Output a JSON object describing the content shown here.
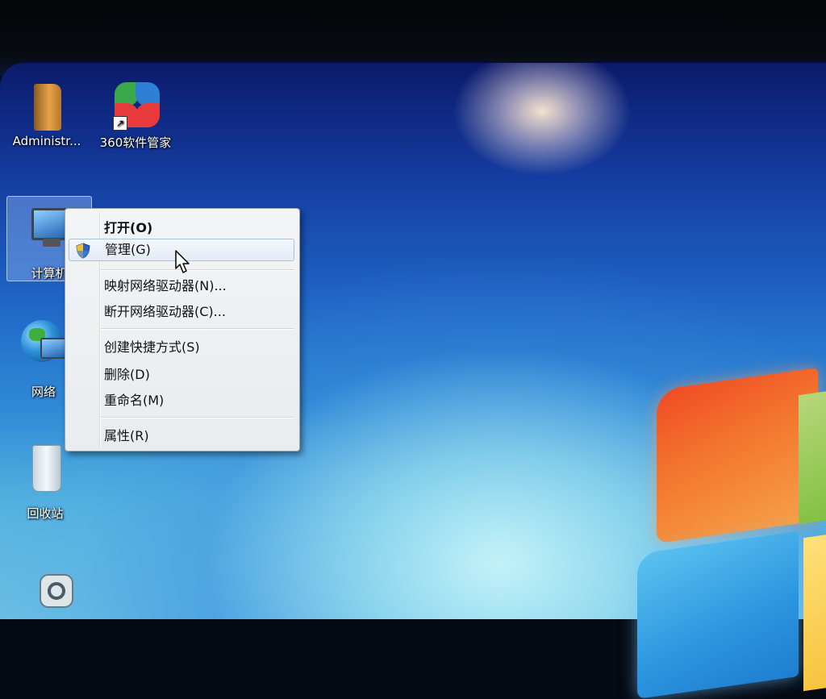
{
  "desktop": {
    "icons": [
      {
        "label": "Administr...",
        "icon": "folder-icon"
      },
      {
        "label": "360软件管家",
        "icon": "360-software-manager-icon"
      },
      {
        "label": "计算机",
        "icon": "computer-icon"
      },
      {
        "label": "网络",
        "icon": "network-globe-icon"
      },
      {
        "label": "回收站",
        "icon": "recycle-bin-icon"
      },
      {
        "label": "",
        "icon": "app-shortcut-icon"
      }
    ]
  },
  "context_menu": {
    "items": [
      {
        "label": "打开(O)",
        "bold": true
      },
      {
        "label": "管理(G)",
        "icon": "uac-shield-icon",
        "highlighted": true
      },
      {
        "label": "映射网络驱动器(N)..."
      },
      {
        "label": "断开网络驱动器(C)..."
      },
      {
        "label": "创建快捷方式(S)"
      },
      {
        "label": "删除(D)"
      },
      {
        "label": "重命名(M)"
      },
      {
        "label": "属性(R)"
      }
    ]
  },
  "colors": {
    "wallpaper_top": "#0b1a6a",
    "wallpaper_bottom": "#74c4e2",
    "menu_bg": "#f0f2f4",
    "menu_highlight_border": "#a8c3e0"
  }
}
